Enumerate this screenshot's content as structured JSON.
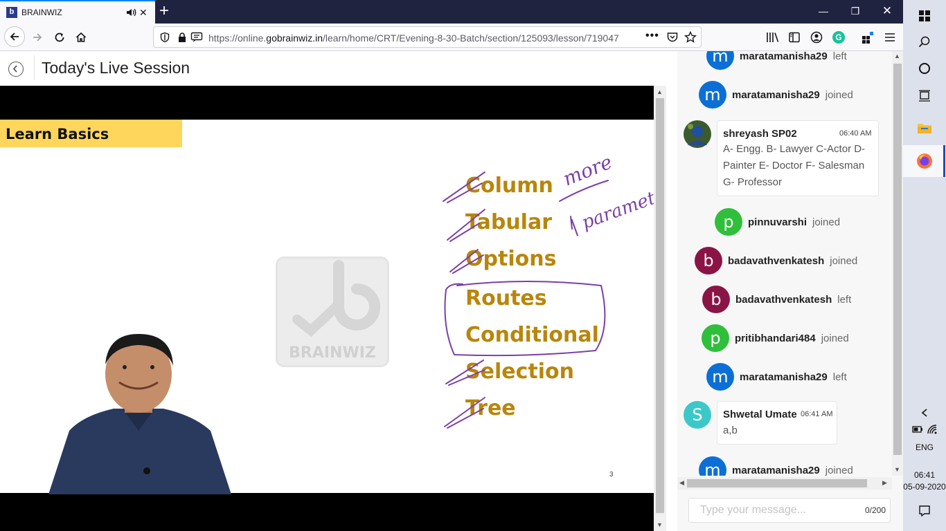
{
  "browser": {
    "tab": {
      "title": "BRAINWIZ",
      "favicon_letter": "b"
    },
    "url": {
      "prefix": "https://online.",
      "domain": "gobrainwiz.in",
      "path": "/learn/home/CRT/Evening-8-30-Batch/section/125093/lesson/719047"
    }
  },
  "page": {
    "title": "Today's Live Session",
    "slide": {
      "heading": "Learn Basics",
      "topics": [
        {
          "label": "Column",
          "struck": true
        },
        {
          "label": "Tabular",
          "struck": true
        },
        {
          "label": "Options",
          "struck": true
        },
        {
          "label": "Routes",
          "struck": false
        },
        {
          "label": "Conditional",
          "struck": false
        },
        {
          "label": "Selection",
          "struck": true
        },
        {
          "label": "Tree",
          "struck": true
        }
      ],
      "handwriting": [
        "more",
        "| parameter"
      ],
      "watermark": "BRAINWIZ",
      "slide_number": "3"
    }
  },
  "chat": {
    "events": [
      {
        "avatar": "m",
        "user": "maratamanisha29",
        "action": "left",
        "color": "#0b6fd6"
      },
      {
        "avatar": "m",
        "user": "maratamanisha29",
        "action": "joined",
        "color": "#0b6fd6"
      },
      {
        "avatar": "p",
        "user": "pinnuvarshi",
        "action": "joined",
        "color": "#2fbf3a"
      },
      {
        "avatar": "b",
        "user": "badavathvenkatesh",
        "action": "joined",
        "color": "#8a1446"
      },
      {
        "avatar": "b",
        "user": "badavathvenkatesh",
        "action": "left",
        "color": "#8a1446"
      },
      {
        "avatar": "p",
        "user": "pritibhandari484",
        "action": "joined",
        "color": "#2fbf3a"
      },
      {
        "avatar": "m",
        "user": "maratamanisha29",
        "action": "left",
        "color": "#0b6fd6"
      },
      {
        "avatar": "m",
        "user": "maratamanisha29",
        "action": "joined",
        "color": "#0b6fd6"
      }
    ],
    "messages": [
      {
        "user": "shreyash SP02",
        "time": "06:40 AM",
        "lines": [
          "A- Engg. B- Lawyer C-Actor D-",
          "Painter E- Doctor F- Salesman",
          "G- Professor"
        ]
      },
      {
        "avatar": "S",
        "user": "Shwetal Umate",
        "time": "06:41 AM",
        "lines": [
          "a,b"
        ],
        "color": "#3cc8c8"
      }
    ],
    "input": {
      "placeholder": "Type your message...",
      "counter": "0/200"
    }
  },
  "taskbar": {
    "language": "ENG",
    "time": "06:41",
    "date": "05-09-2020"
  },
  "colors": {
    "accent_tab": "#0a84ff",
    "titlebar": "#202340",
    "highlight": "#ffd65c",
    "topic_gold": "#b8860b",
    "ink": "#7b3fa6"
  }
}
